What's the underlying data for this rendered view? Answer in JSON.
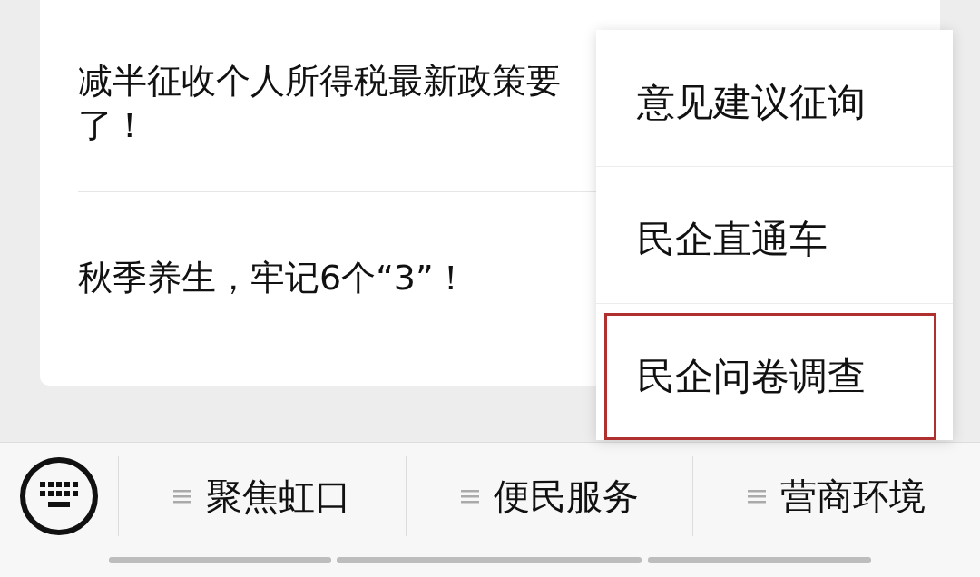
{
  "articles": [
    {
      "lines": [
        "减半征收个人所得税最新政策要",
        "了！"
      ]
    },
    {
      "lines": [
        "秋季养生，牢记6个“3”！"
      ]
    }
  ],
  "popup_menu": {
    "items": [
      {
        "label": "意见建议征询",
        "highlighted": false
      },
      {
        "label": "民企直通车",
        "highlighted": false
      },
      {
        "label": "民企问卷调查",
        "highlighted": true
      }
    ]
  },
  "bottom_menu": {
    "items": [
      {
        "label": "聚焦虹口"
      },
      {
        "label": "便民服务"
      },
      {
        "label": "营商环境"
      }
    ]
  }
}
